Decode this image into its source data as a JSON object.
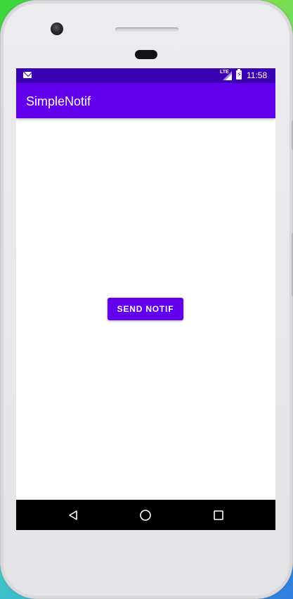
{
  "device": {
    "name": "android-phone-frame"
  },
  "status_bar": {
    "notification_icon": "mail-icon",
    "network_label": "LTE",
    "signal_icon": "signal-icon",
    "battery_icon": "battery-charging-icon",
    "time": "11:58",
    "background_color": "#3a02b3"
  },
  "app_bar": {
    "title": "SimpleNotif",
    "background_color": "#6200ee"
  },
  "main": {
    "send_button_label": "SEND NOTIF",
    "button_color": "#6200ee"
  },
  "nav_bar": {
    "back_icon": "back-triangle-icon",
    "home_icon": "home-circle-icon",
    "recents_icon": "recents-square-icon",
    "background_color": "#000000"
  }
}
